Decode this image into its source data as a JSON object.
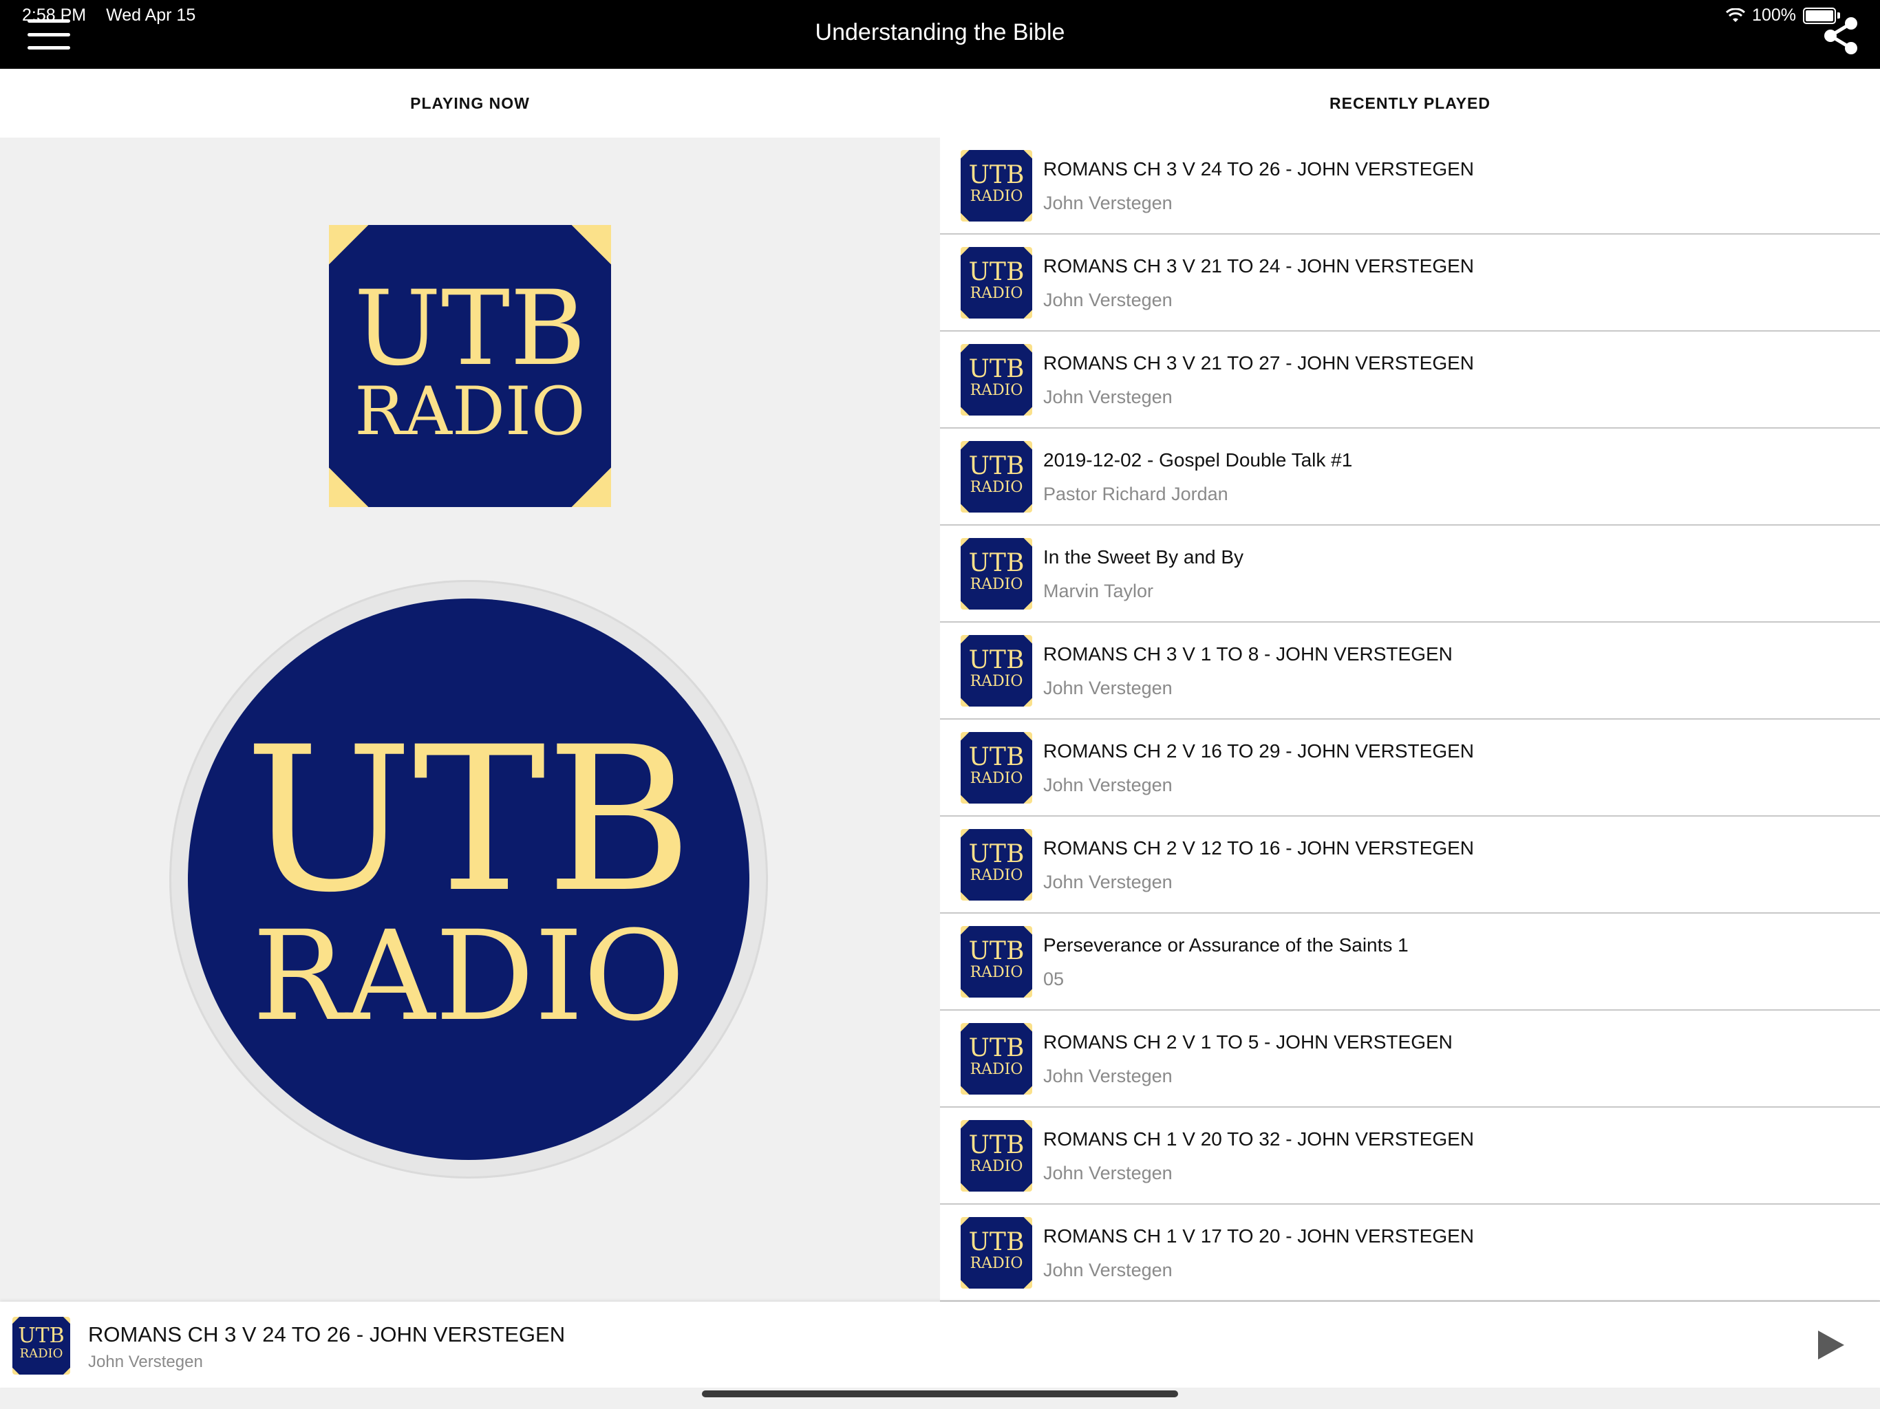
{
  "status_bar": {
    "time": "2:58 PM",
    "date": "Wed Apr 15",
    "battery": "100%"
  },
  "header": {
    "title": "Understanding the Bible"
  },
  "tabs": [
    {
      "label": "PLAYING NOW"
    },
    {
      "label": "RECENTLY PLAYED"
    }
  ],
  "logo": {
    "line1": "UTB",
    "line2": "RADIO"
  },
  "colors": {
    "navy": "#0b1b6b",
    "gold": "#fbe18a"
  },
  "recently_played": [
    {
      "title": "ROMANS CH 3 V 24 TO 26 - JOHN VERSTEGEN",
      "artist": "John Verstegen"
    },
    {
      "title": "ROMANS CH 3 V 21 TO 24 - JOHN VERSTEGEN",
      "artist": "John Verstegen"
    },
    {
      "title": "ROMANS CH 3 V 21 TO 27 - JOHN VERSTEGEN",
      "artist": "John Verstegen"
    },
    {
      "title": "2019-12-02 - Gospel Double Talk #1",
      "artist": "Pastor Richard Jordan"
    },
    {
      "title": "In the Sweet By and By",
      "artist": "Marvin Taylor"
    },
    {
      "title": "ROMANS CH 3 V 1 TO 8 - JOHN VERSTEGEN",
      "artist": "John Verstegen"
    },
    {
      "title": "ROMANS CH 2 V 16 TO 29 - JOHN VERSTEGEN",
      "artist": "John Verstegen"
    },
    {
      "title": "ROMANS CH 2 V 12 TO 16 - JOHN VERSTEGEN",
      "artist": "John Verstegen"
    },
    {
      "title": "Perseverance or Assurance of the Saints 1",
      "artist": "05"
    },
    {
      "title": "ROMANS CH 2 V 1 TO 5 - JOHN VERSTEGEN",
      "artist": "John Verstegen"
    },
    {
      "title": "ROMANS CH 1 V 20 TO 32 - JOHN VERSTEGEN",
      "artist": "John Verstegen"
    },
    {
      "title": "ROMANS CH 1 V 17 TO 20 - JOHN VERSTEGEN",
      "artist": "John Verstegen"
    }
  ],
  "now_playing": {
    "title": "ROMANS CH 3 V 24 TO 26 - JOHN VERSTEGEN",
    "artist": "John Verstegen"
  },
  "icons": {
    "menu": "hamburger-icon",
    "share": "share-icon",
    "play": "play-icon"
  }
}
